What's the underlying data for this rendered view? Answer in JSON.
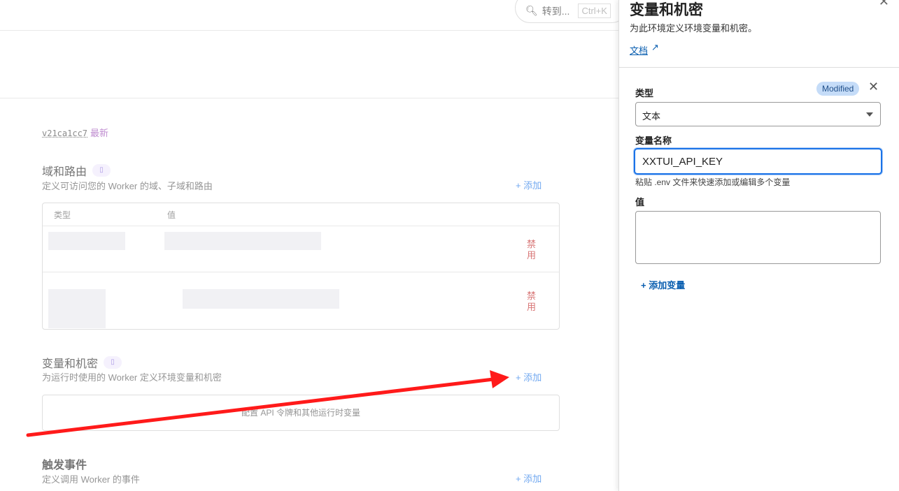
{
  "header": {
    "search_placeholder": "转到...",
    "search_shortcut": "Ctrl+K"
  },
  "version": {
    "id": "v21ca1cc7",
    "tag": "最新"
  },
  "domains": {
    "title": "域和路由",
    "description": "定义可访问您的 Worker 的域、子域和路由",
    "add_label": "+ 添加",
    "columns": [
      "类型",
      "值"
    ],
    "rows": [
      {
        "action": "禁用"
      },
      {
        "action": "禁用"
      }
    ]
  },
  "variables": {
    "title": "变量和机密",
    "description": "为运行时使用的 Worker 定义环境变量和机密",
    "add_label": "+ 添加",
    "empty_text": "配置 API 令牌和其他运行时变量"
  },
  "triggers": {
    "title": "触发事件",
    "description": "定义调用 Worker 的事件",
    "add_label": "+ 添加"
  },
  "panel": {
    "title": "变量和机密",
    "description": "为此环境定义环境变量和机密。",
    "docs_link": "文档",
    "type_label": "类型",
    "modified_badge": "Modified",
    "type_value": "文本",
    "name_label": "变量名称",
    "name_value": "XXTUI_API_KEY",
    "name_hint": "粘贴 .env 文件来快速添加或编辑多个变量",
    "value_label": "值",
    "value_value": "",
    "add_variable": "+ 添加变量"
  },
  "annotation": {
    "arrow_color": "#ff1a1a"
  }
}
